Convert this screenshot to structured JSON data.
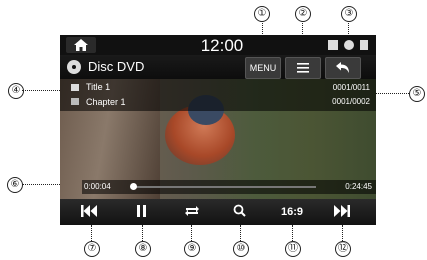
{
  "status_bar": {
    "clock": "12:00"
  },
  "header": {
    "source_title": "Disc DVD",
    "menu_label": "MENU"
  },
  "info_panel": {
    "title": "Title 1",
    "chapter": "Chapter 1",
    "title_count": "0001/0011",
    "chapter_count": "0001/0002"
  },
  "progress": {
    "elapsed": "0:00:04",
    "duration": "0:24:45",
    "fraction": 0.003
  },
  "controls": {
    "aspect_label": "16:9"
  },
  "callouts": [
    "①",
    "②",
    "③",
    "④",
    "⑤",
    "⑥",
    "⑦",
    "⑧",
    "⑨",
    "⑩",
    "⑪",
    "⑫"
  ],
  "colors": {
    "screen_background": "#0c0c0c",
    "control_bar": "#2a2a2a",
    "text": "#ffffff"
  },
  "icons": [
    "home-icon",
    "disc-icon",
    "list-icon",
    "back-icon",
    "folder-icon",
    "film-icon",
    "previous-icon",
    "pause-icon",
    "repeat-icon",
    "search-icon",
    "next-icon"
  ]
}
